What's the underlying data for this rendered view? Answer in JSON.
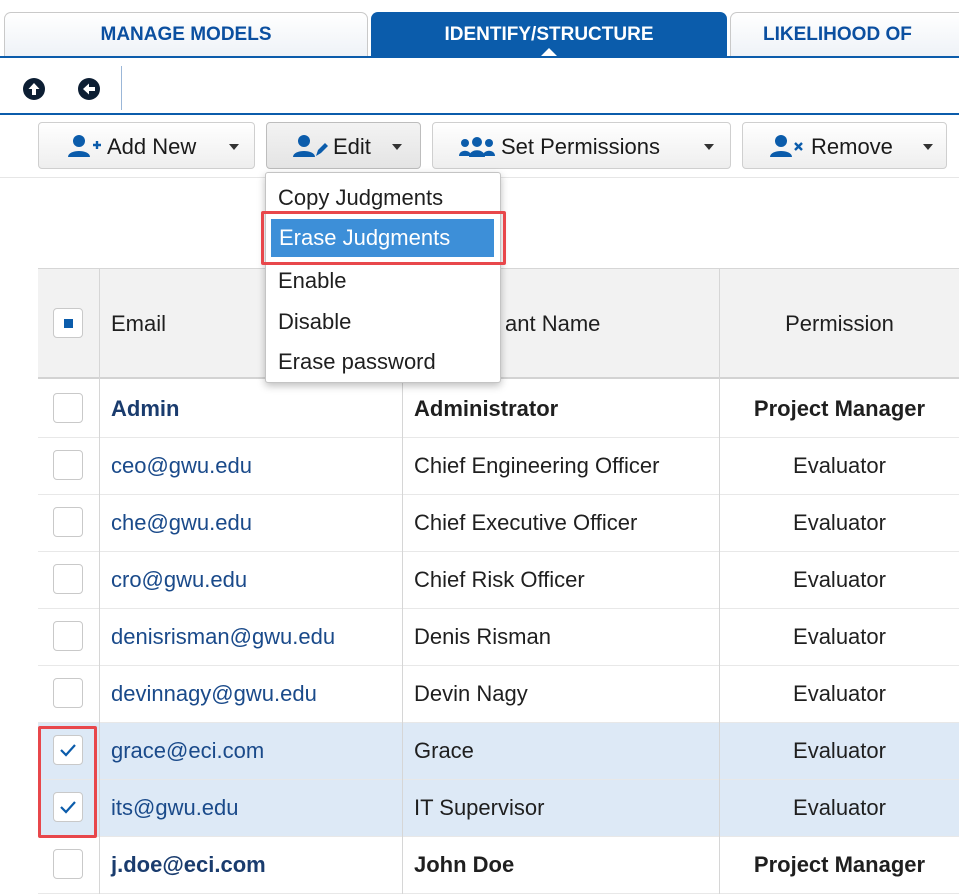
{
  "tabs": [
    {
      "label": "MANAGE MODELS",
      "active": false
    },
    {
      "label": "IDENTIFY/STRUCTURE",
      "active": true
    },
    {
      "label": "LIKELIHOOD OF",
      "active": false
    }
  ],
  "nav": {
    "up_icon": "arrow-up-circle-icon",
    "back_icon": "arrow-left-circle-icon"
  },
  "toolbar": {
    "add_new": {
      "label": "Add New",
      "icon": "user-plus-icon"
    },
    "edit": {
      "label": "Edit",
      "icon": "user-edit-icon"
    },
    "set_permissions": {
      "label": "Set Permissions",
      "icon": "users-group-icon"
    },
    "remove": {
      "label": "Remove",
      "icon": "user-remove-icon"
    }
  },
  "edit_menu": {
    "items": [
      "Copy Judgments",
      "Erase Judgments",
      "Enable",
      "Disable",
      "Erase password"
    ],
    "highlighted": "Erase Judgments"
  },
  "table": {
    "headers": {
      "email": "Email",
      "name": "ant Name",
      "permission": "Permission"
    },
    "rows": [
      {
        "email": "Admin",
        "name": "Administrator",
        "permission": "Project Manager",
        "checked": false,
        "bold": true
      },
      {
        "email": "ceo@gwu.edu",
        "name": "Chief Engineering Officer",
        "permission": "Evaluator",
        "checked": false,
        "bold": false
      },
      {
        "email": "che@gwu.edu",
        "name": "Chief Executive Officer",
        "permission": "Evaluator",
        "checked": false,
        "bold": false
      },
      {
        "email": "cro@gwu.edu",
        "name": "Chief Risk Officer",
        "permission": "Evaluator",
        "checked": false,
        "bold": false
      },
      {
        "email": "denisrisman@gwu.edu",
        "name": "Denis Risman",
        "permission": "Evaluator",
        "checked": false,
        "bold": false
      },
      {
        "email": "devinnagy@gwu.edu",
        "name": "Devin Nagy",
        "permission": "Evaluator",
        "checked": false,
        "bold": false
      },
      {
        "email": "grace@eci.com",
        "name": "Grace",
        "permission": "Evaluator",
        "checked": true,
        "bold": false
      },
      {
        "email": "its@gwu.edu",
        "name": "IT Supervisor",
        "permission": "Evaluator",
        "checked": true,
        "bold": false
      },
      {
        "email": "j.doe@eci.com",
        "name": "John Doe",
        "permission": "Project Manager",
        "checked": false,
        "bold": true
      }
    ]
  },
  "colors": {
    "brand_blue": "#0b5cab",
    "menu_highlight": "#3d8fd8",
    "selected_row": "#dde9f6",
    "annotation_red": "#e8474b"
  }
}
